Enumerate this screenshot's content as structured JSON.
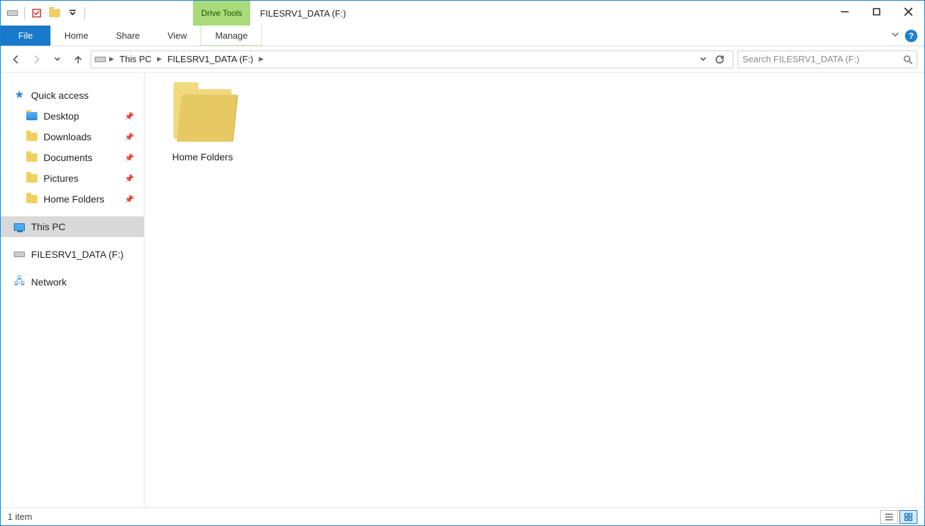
{
  "titlebar": {
    "context_tab": "Drive Tools",
    "window_title": "FILESRV1_DATA (F:)"
  },
  "ribbon": {
    "file": "File",
    "tabs": [
      "Home",
      "Share",
      "View"
    ],
    "context_manage": "Manage"
  },
  "breadcrumb": {
    "root": "This PC",
    "current": "FILESRV1_DATA (F:)"
  },
  "search": {
    "placeholder": "Search FILESRV1_DATA (F:)"
  },
  "sidebar": {
    "quick_access": "Quick access",
    "items": [
      {
        "label": "Desktop",
        "pinned": true
      },
      {
        "label": "Downloads",
        "pinned": true
      },
      {
        "label": "Documents",
        "pinned": true
      },
      {
        "label": "Pictures",
        "pinned": true
      },
      {
        "label": "Home Folders",
        "pinned": true
      }
    ],
    "this_pc": "This PC",
    "drive": "FILESRV1_DATA (F:)",
    "network": "Network"
  },
  "content": {
    "items": [
      {
        "name": "Home Folders",
        "type": "folder"
      }
    ]
  },
  "statusbar": {
    "count": "1 item"
  }
}
